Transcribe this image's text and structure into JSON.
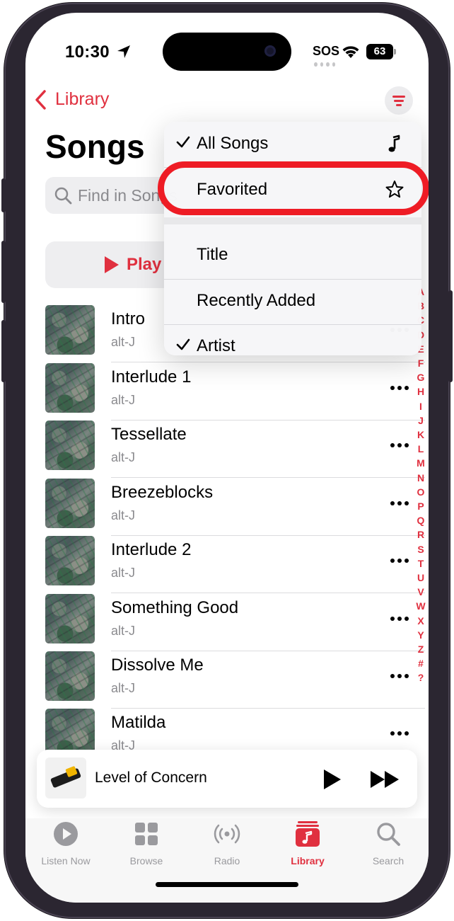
{
  "status_bar": {
    "time": "10:30",
    "sos": "SOS",
    "battery": "63"
  },
  "nav": {
    "back_label": "Library"
  },
  "page": {
    "title": "Songs",
    "search_placeholder": "Find in Songs",
    "play_label": "Play"
  },
  "menu": {
    "items": [
      {
        "label": "All Songs",
        "checked": true,
        "icon": "music-note-icon"
      },
      {
        "label": "Favorited",
        "checked": false,
        "icon": "star-icon"
      },
      {
        "label": "Title",
        "checked": false
      },
      {
        "label": "Recently Added",
        "checked": false
      },
      {
        "label": "Artist",
        "checked": true
      }
    ]
  },
  "songs": [
    {
      "title": "Intro",
      "artist": "alt-J"
    },
    {
      "title": "Interlude 1",
      "artist": "alt-J"
    },
    {
      "title": "Tessellate",
      "artist": "alt-J"
    },
    {
      "title": "Breezeblocks",
      "artist": "alt-J"
    },
    {
      "title": "Interlude 2",
      "artist": "alt-J"
    },
    {
      "title": "Something Good",
      "artist": "alt-J"
    },
    {
      "title": "Dissolve Me",
      "artist": "alt-J"
    },
    {
      "title": "Matilda",
      "artist": "alt-J"
    }
  ],
  "alphabet": [
    "A",
    "B",
    "C",
    "D",
    "E",
    "F",
    "G",
    "H",
    "I",
    "J",
    "K",
    "L",
    "M",
    "N",
    "O",
    "P",
    "Q",
    "R",
    "S",
    "T",
    "U",
    "V",
    "W",
    "X",
    "Y",
    "Z",
    "#",
    "?"
  ],
  "mini_player": {
    "title": "Level of Concern"
  },
  "tabs": [
    {
      "label": "Listen Now",
      "icon": "play-circle-icon",
      "active": false
    },
    {
      "label": "Browse",
      "icon": "grid-icon",
      "active": false
    },
    {
      "label": "Radio",
      "icon": "radio-waves-icon",
      "active": false
    },
    {
      "label": "Library",
      "icon": "library-icon",
      "active": true
    },
    {
      "label": "Search",
      "icon": "search-icon",
      "active": false
    }
  ],
  "colors": {
    "accent": "#e0303f",
    "highlight_ring": "#ee1c25"
  }
}
